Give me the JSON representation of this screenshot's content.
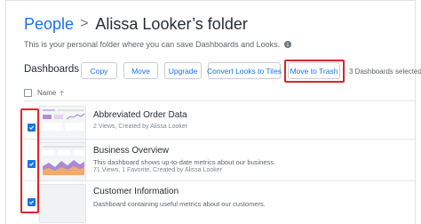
{
  "breadcrumb": {
    "parent": "People",
    "separator": ">",
    "current": "Alissa Looker’s folder"
  },
  "subtitle": "This is your personal folder where you can save Dashboards and Looks.",
  "toolbar": {
    "section_title": "Dashboards",
    "copy_label": "Copy",
    "move_label": "Move",
    "upgrade_label": "Upgrade",
    "convert_label": "Convert Looks to Tiles",
    "trash_label": "Move to Trash",
    "count_text": "3 Dashboards selected"
  },
  "list": {
    "column_name": "Name",
    "sort": "ascending",
    "items": [
      {
        "title": "Abbreviated Order Data",
        "description": "",
        "meta": "2 Views, Created by Alissa Looker",
        "checked": true
      },
      {
        "title": "Business Overview",
        "description": "This dashboard shows up-to-date metrics about our business.",
        "meta": "71 Views, 1 Favorite, Created by Alissa Looker",
        "checked": true
      },
      {
        "title": "Customer Information",
        "description": "Dashboard containing useful metrics about our customers.",
        "meta": "",
        "checked": true
      }
    ]
  },
  "colors": {
    "accent": "#1a73e8",
    "highlight": "#d9262b",
    "text": "#262d33",
    "muted": "#5f6368"
  },
  "icons": {
    "info": "info-icon",
    "sort": "arrow-up-icon",
    "check": "check-icon"
  }
}
